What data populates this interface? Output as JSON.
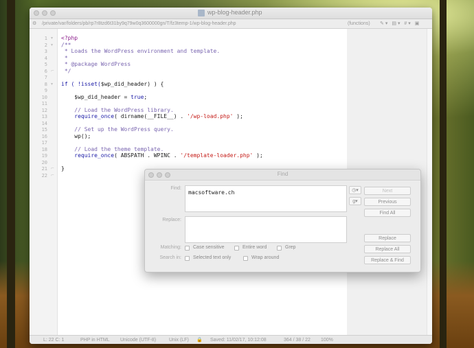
{
  "editor": {
    "title": "wp-blog-header.php",
    "path": "/private/var/folders/pb/rp7r8tzd6t31by9q79w0q3600000gn/T/fz3temp-1/wp-blog-header.php",
    "functions_menu": "(functions)",
    "gear_symbol": "⚙",
    "tool_icons": "✎▾ ▤▾ #▾ ▣",
    "gutter": {
      "lines": [
        "1",
        "2",
        "3",
        "4",
        "5",
        "6",
        "7",
        "8",
        "9",
        "10",
        "11",
        "12",
        "13",
        "14",
        "15",
        "16",
        "17",
        "18",
        "19",
        "20",
        "21",
        "22"
      ],
      "fold_down": "▾",
      "fold_up": "⌐"
    },
    "code": {
      "l1": "<?php",
      "l2": "/**",
      "l3": " * Loads the WordPress environment and template.",
      "l4": " *",
      "l5": " * @package WordPress",
      "l6": " */",
      "l8a": "if ( !isset(",
      "l8b": "$wp_did_header",
      "l8c": ") ) {",
      "l10a": "    $wp_did_header",
      "l10b": " = ",
      "l10c": "true",
      "l10d": ";",
      "l12": "    // Load the WordPress library.",
      "l13a": "    require_once",
      "l13b": "( dirname(__FILE__) . ",
      "l13c": "'/wp-load.php'",
      "l13d": " );",
      "l15": "    // Set up the WordPress query.",
      "l16": "    wp();",
      "l18": "    // Load the theme template.",
      "l19a": "    require_once",
      "l19b": "( ABSPATH . WPINC . ",
      "l19c": "'/template-loader.php'",
      "l19d": " );",
      "l21": "}"
    },
    "status": {
      "position": "L: 22 C: 1",
      "language": "PHP in HTML",
      "encoding": "Unicode (UTF-8)",
      "line_endings": "Unix (LF)",
      "lock": "🔒",
      "saved": "Saved: 11/02/17, 10:12:08",
      "stats": "364 / 38 / 22",
      "zoom": "100%"
    }
  },
  "find": {
    "title": "Find",
    "find_label": "Find:",
    "find_value": "macsoftware.ch",
    "replace_label": "Replace:",
    "history_icon": "◷▾",
    "grep_icon": "g▾",
    "buttons": {
      "next": "Next",
      "previous": "Previous",
      "find_all": "Find All",
      "replace": "Replace",
      "replace_all": "Replace All",
      "replace_and_find": "Replace & Find"
    },
    "matching_label": "Matching:",
    "search_in_label": "Search in:",
    "options": {
      "case_sensitive": "Case sensitive",
      "entire_word": "Entire word",
      "grep": "Grep",
      "selected_text_only": "Selected text only",
      "wrap_around": "Wrap around"
    }
  }
}
